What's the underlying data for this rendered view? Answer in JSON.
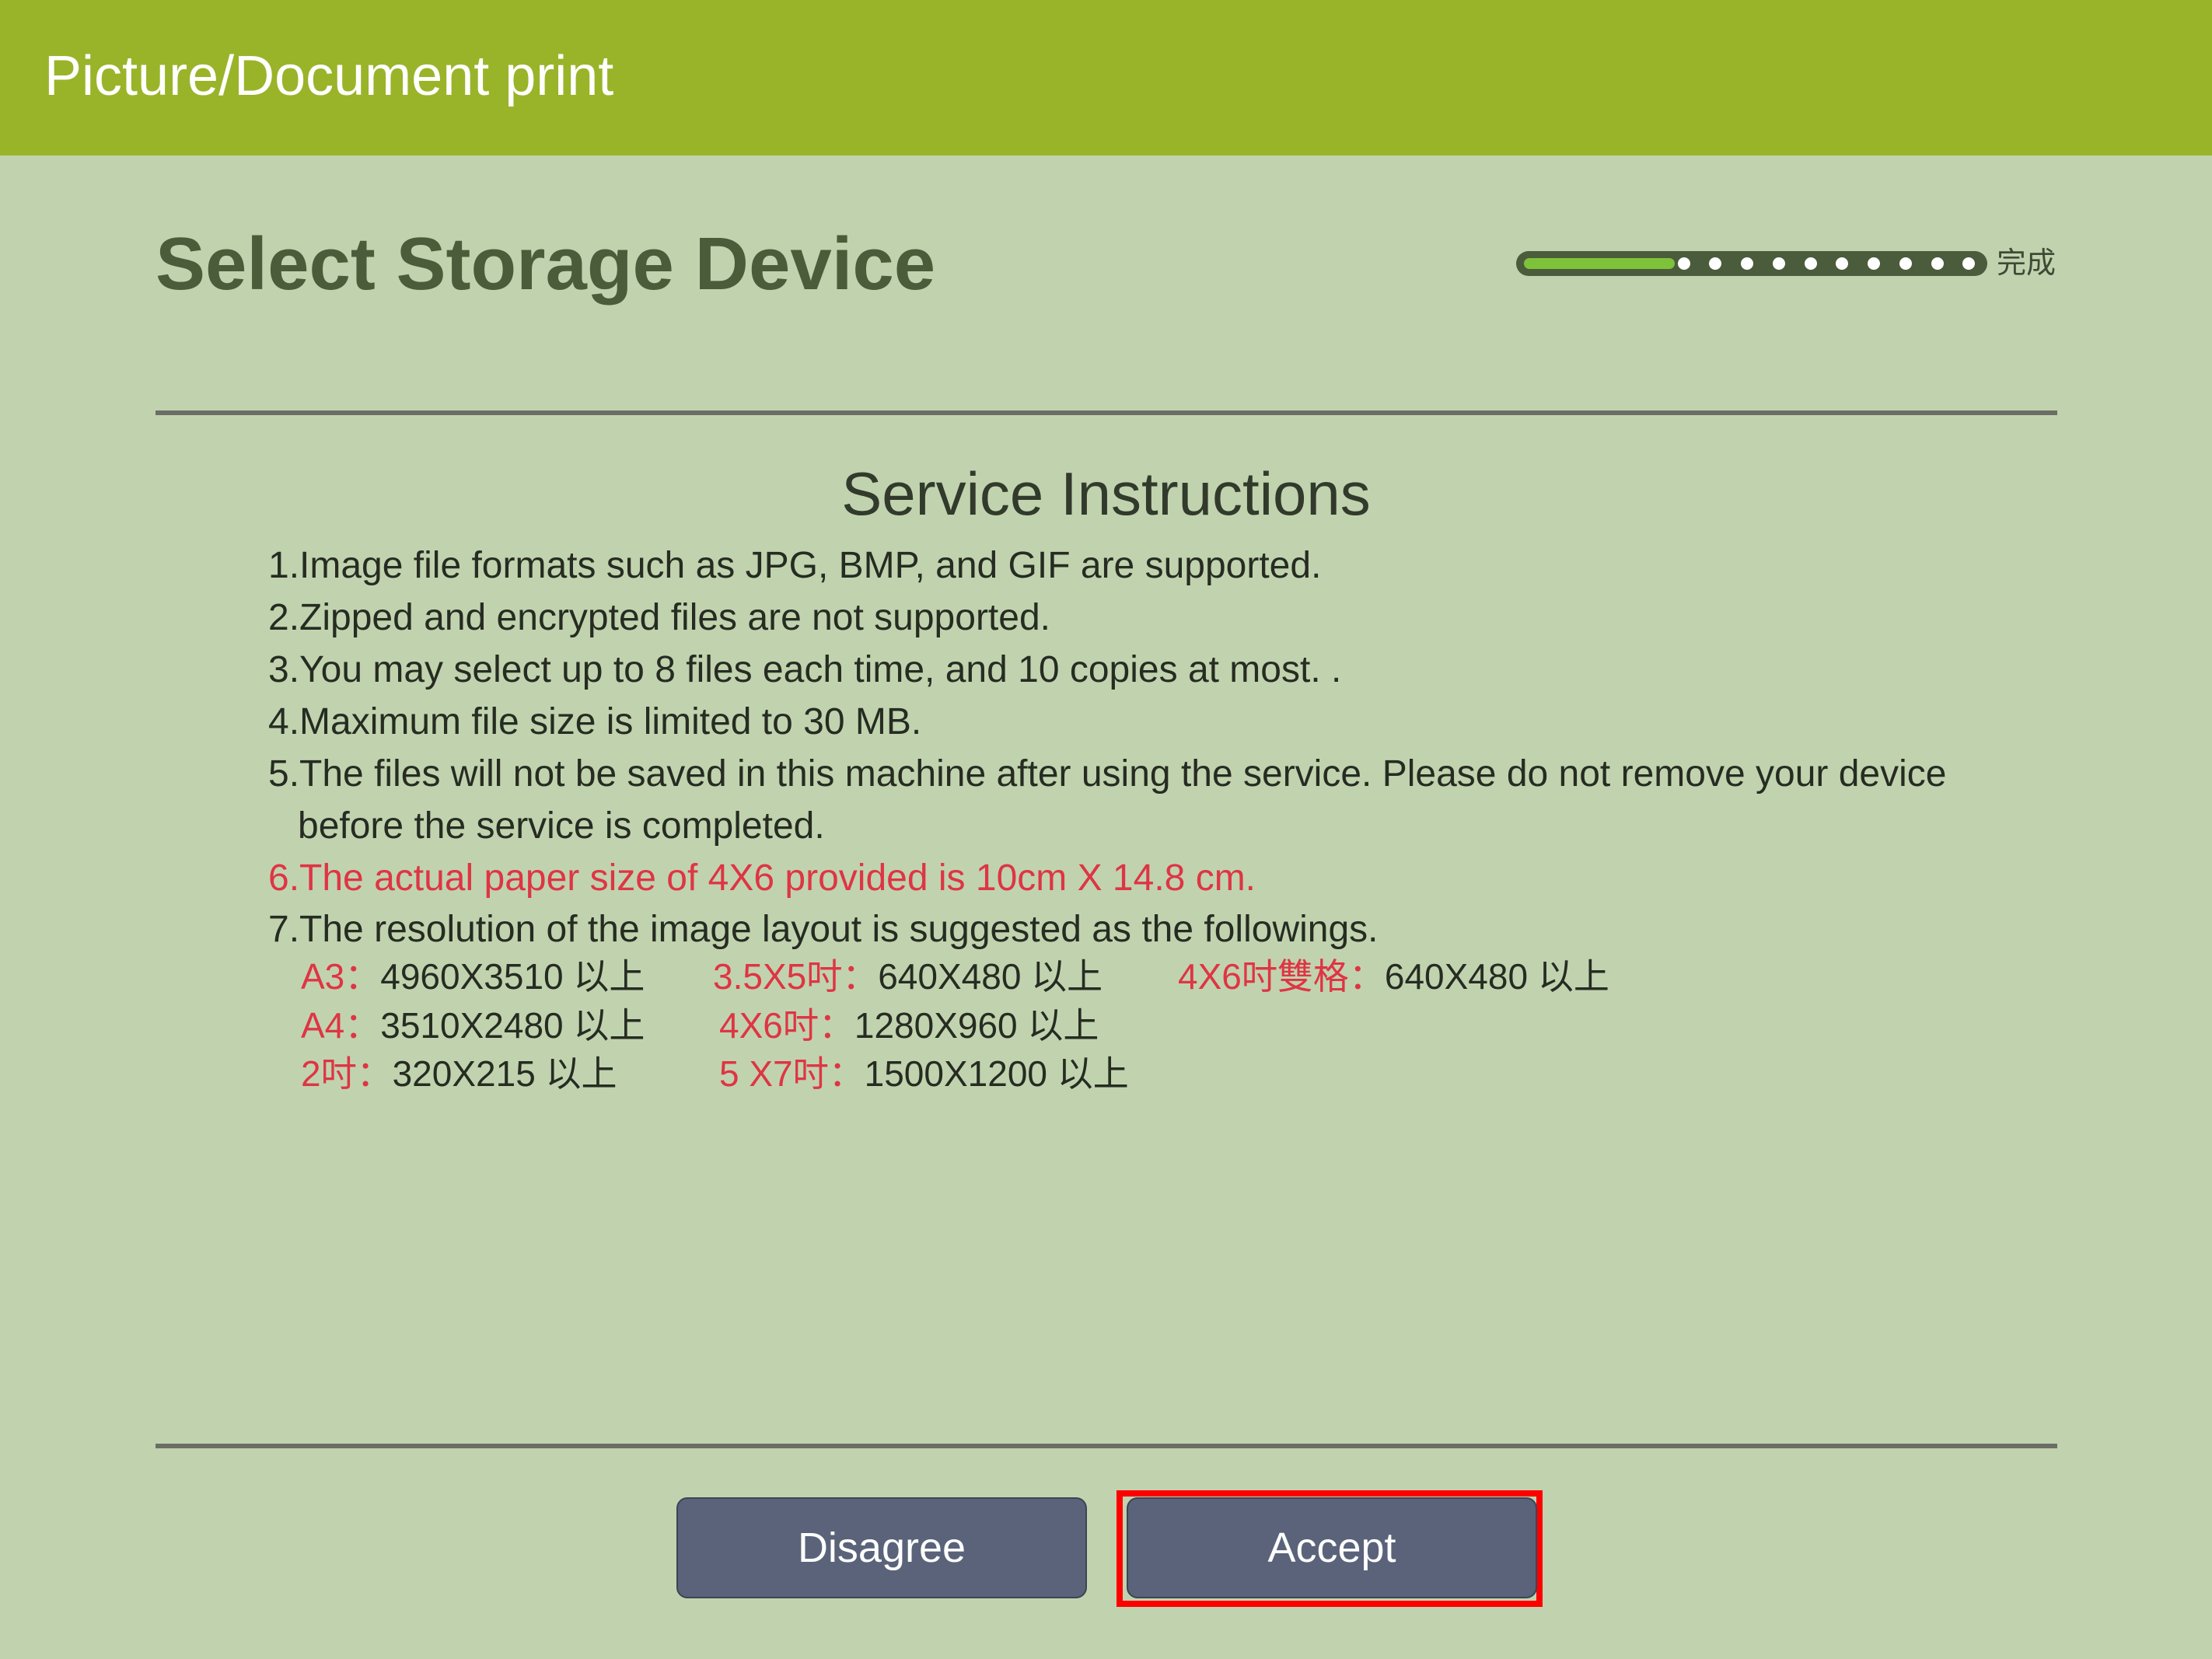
{
  "header": {
    "title": "Picture/Document print"
  },
  "page": {
    "title": "Select Storage Device"
  },
  "progress": {
    "value": 0.32,
    "label": "完成"
  },
  "instructions": {
    "heading": "Service Instructions",
    "items": [
      "1.Image file formats such as JPG, BMP, and GIF are supported.",
      "2.Zipped and encrypted files are not supported.",
      "3.You may select up to 8 files each time, and 10 copies at most.  .",
      "4.Maximum file size is limited to 30 MB.",
      "5.The files will not be saved in this machine after using the service. Please do not remove your device",
      "before the service is completed.",
      "6.The actual paper size of 4X6 provided is 10cm X 14.8 cm.",
      "7.The resolution of the image layout is suggested as the followings."
    ],
    "resolutions": [
      {
        "name": "A3：",
        "value": "4960X3510 以上"
      },
      {
        "name": "3.5X5吋：",
        "value": "640X480 以上"
      },
      {
        "name": "4X6吋雙格：",
        "value": "640X480 以上"
      },
      {
        "name": "A4：",
        "value": "3510X2480 以上"
      },
      {
        "name": "4X6吋：",
        "value": "1280X960 以上"
      },
      {
        "name": "2吋：",
        "value": "320X215 以上"
      },
      {
        "name": "5 X7吋：",
        "value": "1500X1200 以上"
      }
    ]
  },
  "buttons": {
    "disagree": "Disagree",
    "accept": "Accept"
  },
  "colors": {
    "header": "#99b429",
    "background": "#c1d3ae",
    "highlight": "#de3545",
    "button": "#5a6379"
  }
}
